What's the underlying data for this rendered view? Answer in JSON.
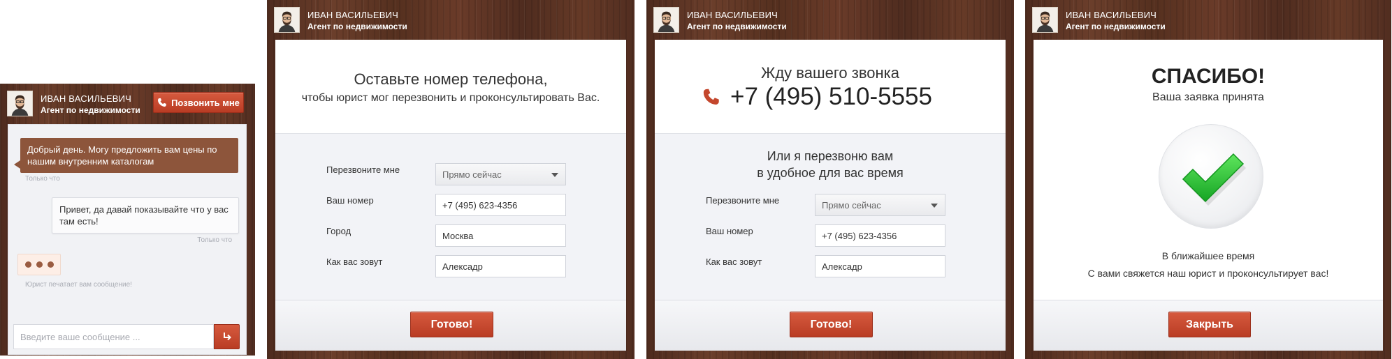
{
  "agent": {
    "name": "ИВАН ВАСИЛЬЕВИЧ",
    "role": "Агент по недвижимости"
  },
  "chat": {
    "call_button_label": "Позвонить мне",
    "agent_message": "Добрый день. Могу предложить вам цены по нашим внутренним каталогам",
    "agent_message_time": "Только что",
    "user_message": "Привет, да давай показывайте что у вас там есть!",
    "user_message_time": "Только что",
    "typing_status": "Юрист печатает вам сообщение!",
    "input_placeholder": "Введите ваше сообщение ..."
  },
  "callback_form": {
    "title": "Оставьте номер телефона,",
    "subtitle": "чтобы юрист мог перезвонить и проконсультировать Вас.",
    "rows": [
      {
        "label": "Перезвоните мне",
        "value": "Прямо сейчас"
      },
      {
        "label": "Ваш номер",
        "value": "+7 (495) 623-4356"
      },
      {
        "label": "Город",
        "value": "Москва"
      },
      {
        "label": "Как вас зовут",
        "value": "Алексадр"
      }
    ],
    "submit_label": "Готово!"
  },
  "phone_form": {
    "title": "Жду вашего звонка",
    "phone": "+7 (495) 510-5555",
    "alt_line1": "Или я перезвоню вам",
    "alt_line2": "в удобное для вас время",
    "rows": [
      {
        "label": "Перезвоните мне",
        "value": "Прямо сейчас"
      },
      {
        "label": "Ваш номер",
        "value": "+7 (495) 623-4356"
      },
      {
        "label": "Как вас зовут",
        "value": "Алексадр"
      }
    ],
    "submit_label": "Готово!"
  },
  "thanks": {
    "title": "СПАСИБО!",
    "subtitle": "Ваша заявка принята",
    "line1": "В ближайшее время",
    "line2": "С вами свяжется наш юрист и проконсультирует вас!",
    "close_label": "Закрыть"
  },
  "colors": {
    "accent_red": "#c4472d",
    "wood_brown": "#5a3323",
    "agent_bubble": "#8d553b",
    "check_green": "#2fc63a"
  },
  "icons": [
    "phone-icon",
    "send-arrow-icon",
    "dropdown-caret-icon",
    "checkmark-icon",
    "avatar-icon"
  ]
}
